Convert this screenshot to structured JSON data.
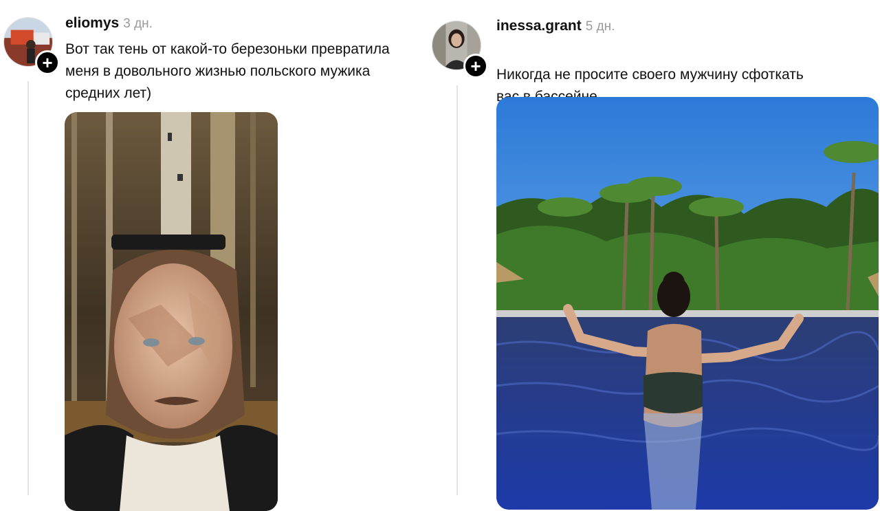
{
  "posts": [
    {
      "username": "eliomys",
      "time": "3 дн.",
      "caption": "Вот так тень от какой-то березоньки превратила\nменя в довольного жизнью польского мужика\nсредних лет)",
      "follow_icon": "plus-icon",
      "follow_symbol": "+"
    },
    {
      "username": "inessa.grant",
      "time": "5 дн.",
      "caption": "Никогда не просите своего мужчину сфоткать\nвас в бассейне",
      "emojis": "😅 😅 😅 😅",
      "follow_icon": "plus-icon",
      "follow_symbol": "+"
    }
  ],
  "colors": {
    "text": "#111111",
    "meta": "#9a9a9a",
    "thread_line": "#e3e3e3",
    "badge": "#000000"
  }
}
